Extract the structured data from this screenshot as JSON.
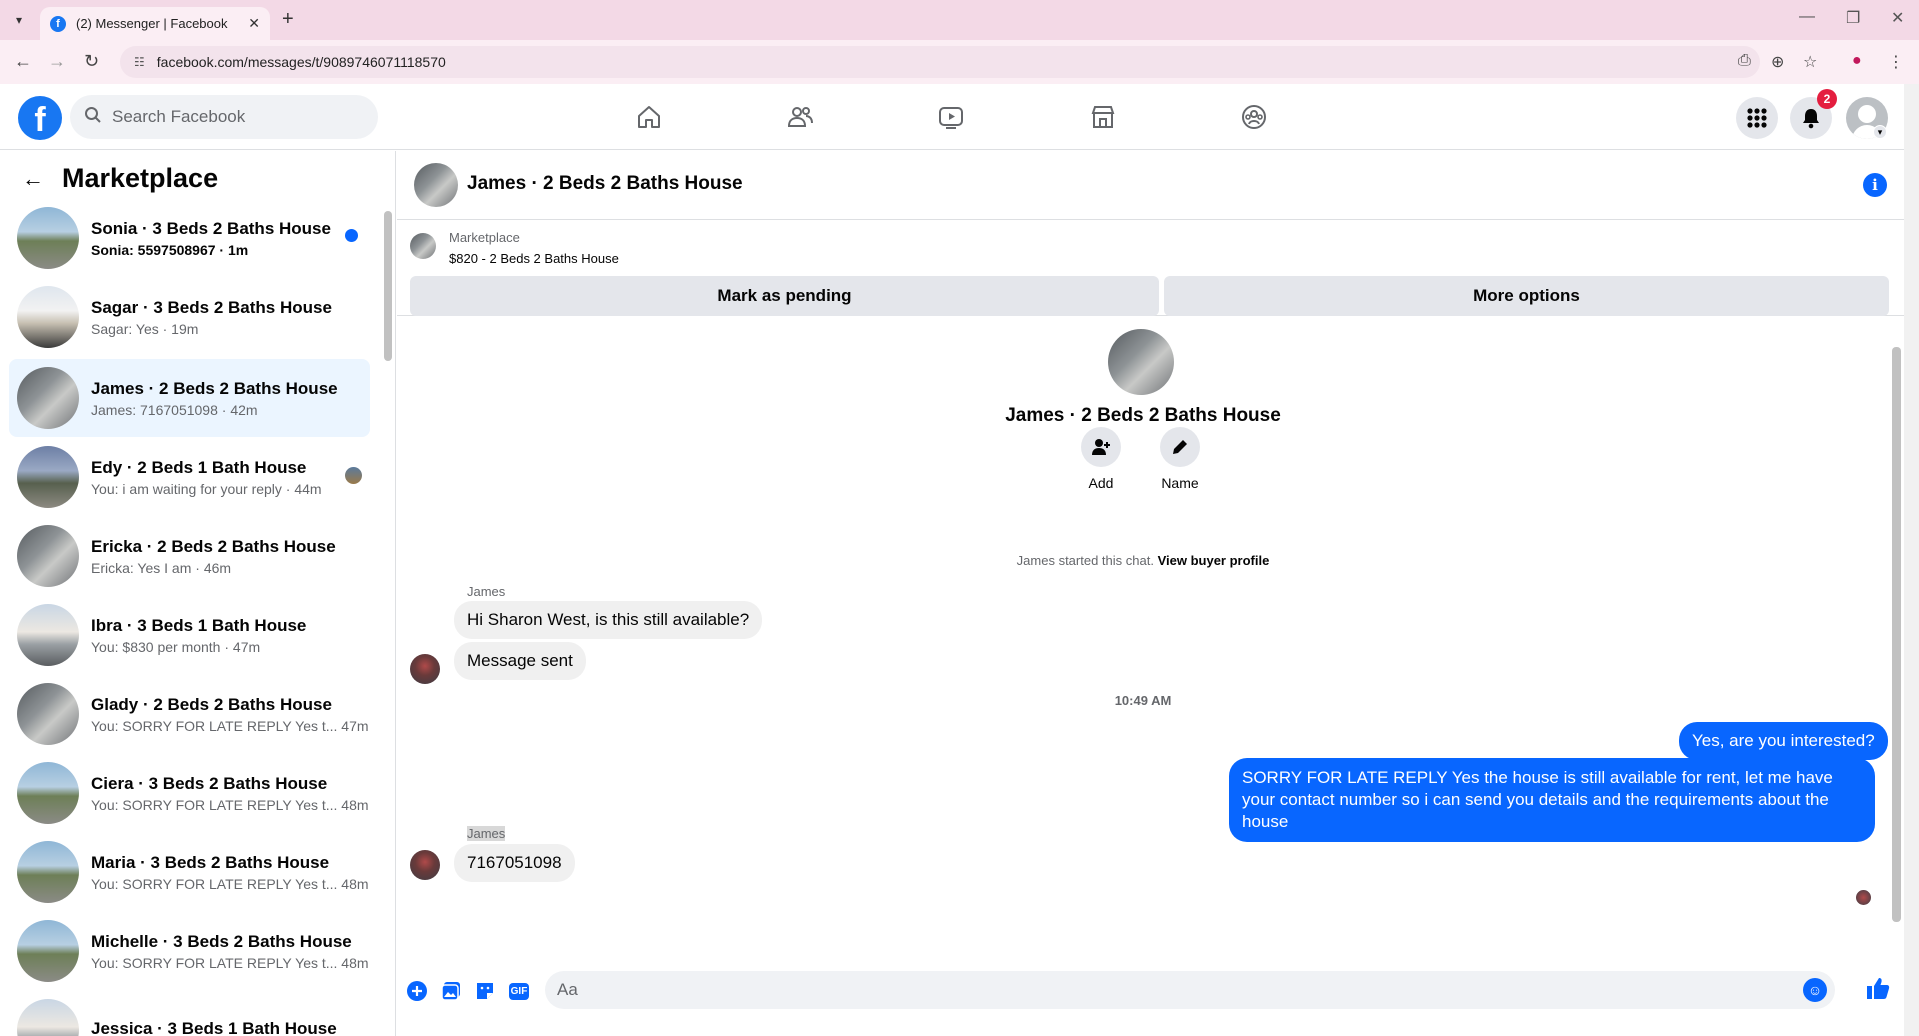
{
  "browser": {
    "tab_title": "(2) Messenger | Facebook",
    "url": "facebook.com/messages/t/9089746071118570"
  },
  "header": {
    "search_placeholder": "Search Facebook",
    "notification_count": "2"
  },
  "sidebar": {
    "title": "Marketplace",
    "conversations": [
      {
        "name": "Sonia · 3 Beds 2 Baths House",
        "preview": "Sonia: 5597508967 · 1m",
        "unread": true
      },
      {
        "name": "Sagar · 3 Beds 2 Baths House",
        "preview": "Sagar: Yes · 19m"
      },
      {
        "name": "James · 2 Beds 2 Baths House",
        "preview": "James: 7167051098 · 42m",
        "active": true
      },
      {
        "name": "Edy · 2 Beds 1 Bath House",
        "preview": "You: i am waiting for your reply · 44m"
      },
      {
        "name": "Ericka · 2 Beds 2 Baths House",
        "preview": "Ericka: Yes I am · 46m"
      },
      {
        "name": "Ibra · 3 Beds 1 Bath House",
        "preview": "You: $830 per month · 47m"
      },
      {
        "name": "Glady · 2 Beds 2 Baths House",
        "preview": "You: SORRY FOR LATE REPLY Yes t... 47m"
      },
      {
        "name": "Ciera · 3 Beds 2 Baths House",
        "preview": "You: SORRY FOR LATE REPLY Yes t... 48m"
      },
      {
        "name": "Maria · 3 Beds 2 Baths House",
        "preview": "You: SORRY FOR LATE REPLY Yes t... 48m"
      },
      {
        "name": "Michelle · 3 Beds 2 Baths House",
        "preview": "You: SORRY FOR LATE REPLY Yes t... 48m"
      },
      {
        "name": "Jessica · 3 Beds 1 Bath House",
        "preview": ""
      }
    ]
  },
  "chat": {
    "title": "James · 2 Beds 2 Baths House",
    "marketplace_label": "Marketplace",
    "listing": "$820 - 2 Beds 2 Baths House",
    "mark_pending_label": "Mark as pending",
    "more_options_label": "More options",
    "intro_title": "James · 2 Beds 2 Baths House",
    "add_label": "Add",
    "name_label": "Name",
    "started_text": "James started this chat.",
    "view_profile_label": "View buyer profile",
    "sender_1": "James",
    "msg_1": "Hi Sharon West, is this still available?",
    "msg_2": "Message sent",
    "timestamp": "10:49 AM",
    "out_1": "Yes, are you interested?",
    "out_2": "SORRY FOR LATE REPLY Yes the house is still available for rent, let me have your contact number so i can send you details and the requirements about the house",
    "sender_2": "James",
    "msg_3": "7167051098",
    "composer_placeholder": "Aa",
    "gif_label": "GIF"
  }
}
